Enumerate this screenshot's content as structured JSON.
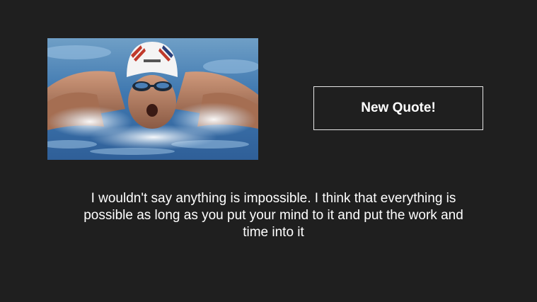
{
  "image": {
    "description": "swimmer-photo"
  },
  "button": {
    "label": "New Quote!"
  },
  "quote": {
    "text": "I wouldn't say anything is impossible. I think that everything is possible as long as you put your mind to it and put the work and time into it"
  }
}
